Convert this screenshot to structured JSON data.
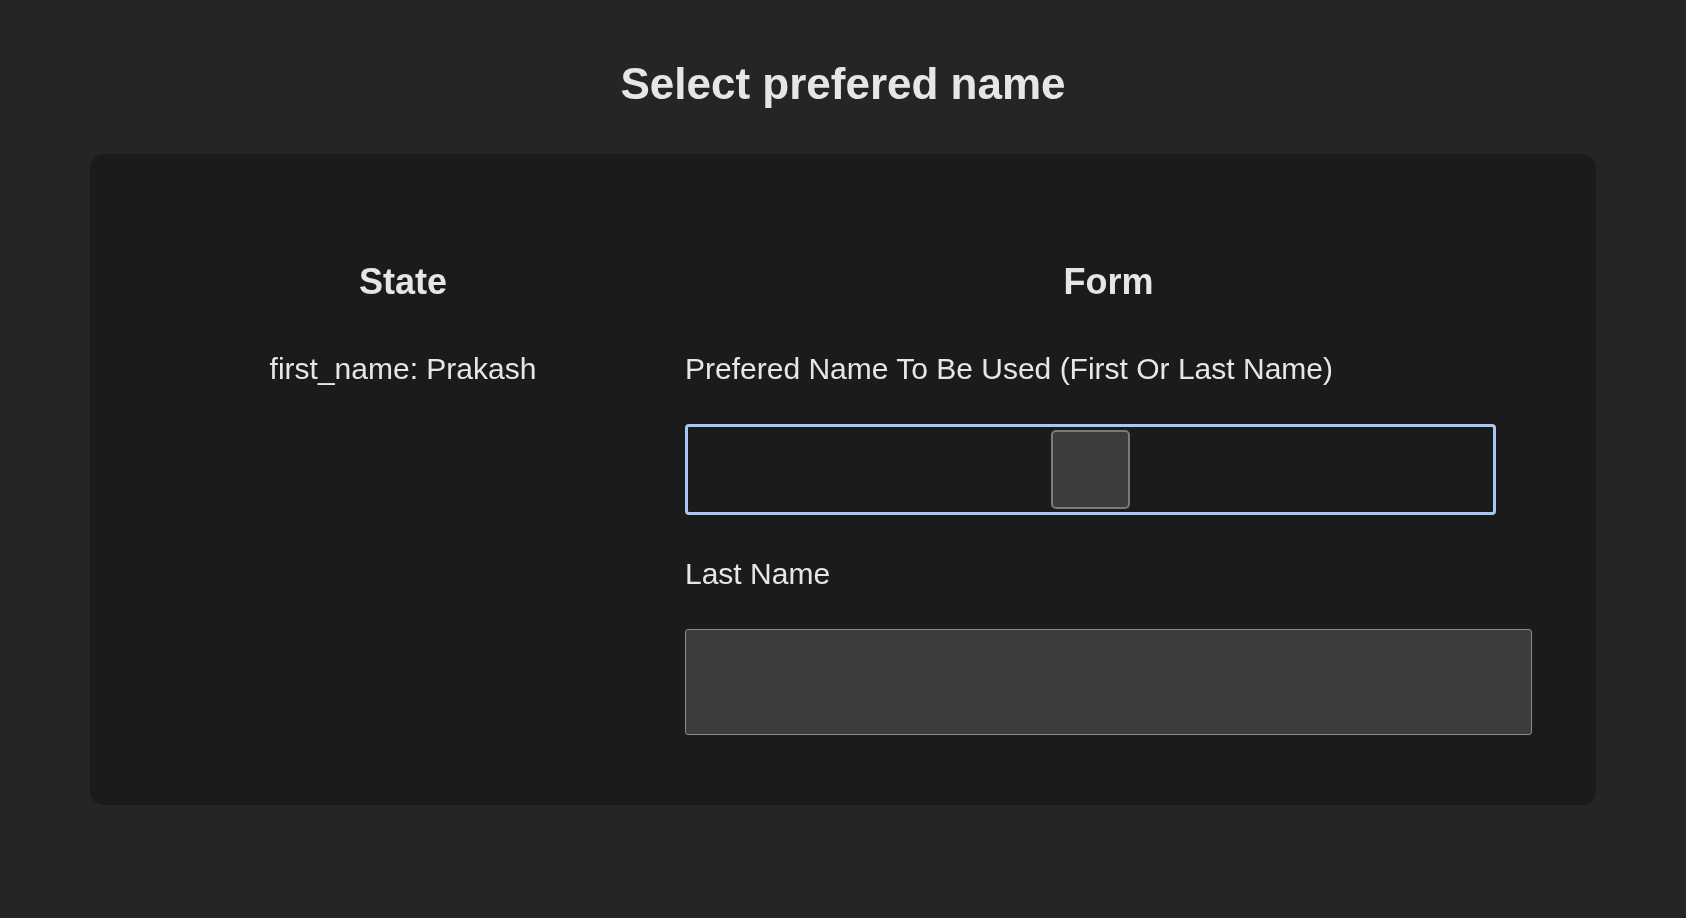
{
  "title": "Select prefered name",
  "state_panel": {
    "heading": "State",
    "entries": [
      "first_name: Prakash"
    ]
  },
  "form": {
    "heading": "Form",
    "fields": [
      {
        "kind": "select",
        "label": "Prefered Name To Be Used (First Or Last Name)",
        "focused": true
      },
      {
        "kind": "text",
        "label": "Last Name",
        "focused": false
      }
    ]
  }
}
